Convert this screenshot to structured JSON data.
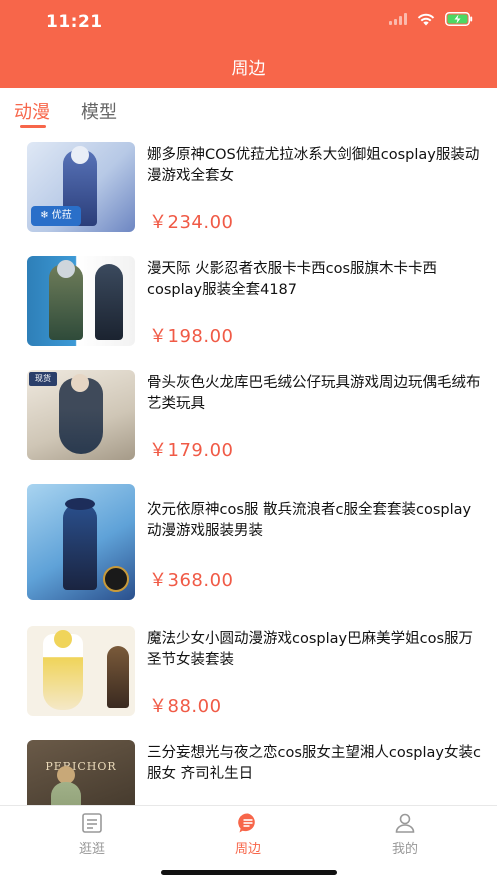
{
  "status_bar": {
    "time": "11:21"
  },
  "header": {
    "title": "周边"
  },
  "tabs": [
    {
      "label": "动漫",
      "active": true
    },
    {
      "label": "模型",
      "active": false
    }
  ],
  "products": [
    {
      "title": "娜多原神COS优菈尤拉冰系大剑御姐cosplay服装动漫游戏全套女",
      "price": "￥234.00",
      "thumb_colors": [
        "#cfdcef",
        "#5873b8",
        "#2b3e7a"
      ],
      "thumb_icon": "snowflake-badge-icon"
    },
    {
      "title": "漫天际 火影忍者衣服卡卡西cos服旗木卡卡西cosplay服装全套4187",
      "price": "￥198.00",
      "thumb_colors": [
        "#2e7fb8",
        "#2f4b3a",
        "#1b2330"
      ],
      "thumb_icon": "ninja-figure-icon"
    },
    {
      "title": "骨头灰色火龙库巴毛绒公仔玩具游戏周边玩偶毛绒布艺类玩具",
      "price": "￥179.00",
      "thumb_colors": [
        "#d9d2c6",
        "#3f4a5a",
        "#2a3a4f"
      ],
      "thumb_icon": "dress-figure-icon"
    },
    {
      "title": "次元依原神cos服 散兵流浪者c服全套套装cosplay动漫游戏服装男装",
      "price": "￥368.00",
      "thumb_colors": [
        "#7fb8e0",
        "#2a4f8c",
        "#1a2440"
      ],
      "thumb_icon": "wanderer-figure-icon"
    },
    {
      "title": "魔法少女小圆动漫游戏cosplay巴麻美学姐cos服万圣节女装套装",
      "price": "￥88.00",
      "thumb_colors": [
        "#f4e8c8",
        "#f0d45a",
        "#3a2a20"
      ],
      "thumb_icon": "magical-girl-figure-icon"
    },
    {
      "title": "三分妄想光与夜之恋cos服女主望湘人cosplay女装c服女 齐司礼生日",
      "price": "",
      "thumb_colors": [
        "#5a4a3a",
        "#c8a878",
        "#8a9a70"
      ],
      "thumb_icon": "peri-chor-figure-icon",
      "thumb_text": "PERICHOR"
    }
  ],
  "tabbar": [
    {
      "label": "逛逛",
      "icon": "list-doc-icon",
      "active": false
    },
    {
      "label": "周边",
      "icon": "chat-bubble-icon",
      "active": true
    },
    {
      "label": "我的",
      "icon": "person-icon",
      "active": false
    }
  ],
  "colors": {
    "brand": "#f7664a",
    "price": "#f05a46"
  }
}
